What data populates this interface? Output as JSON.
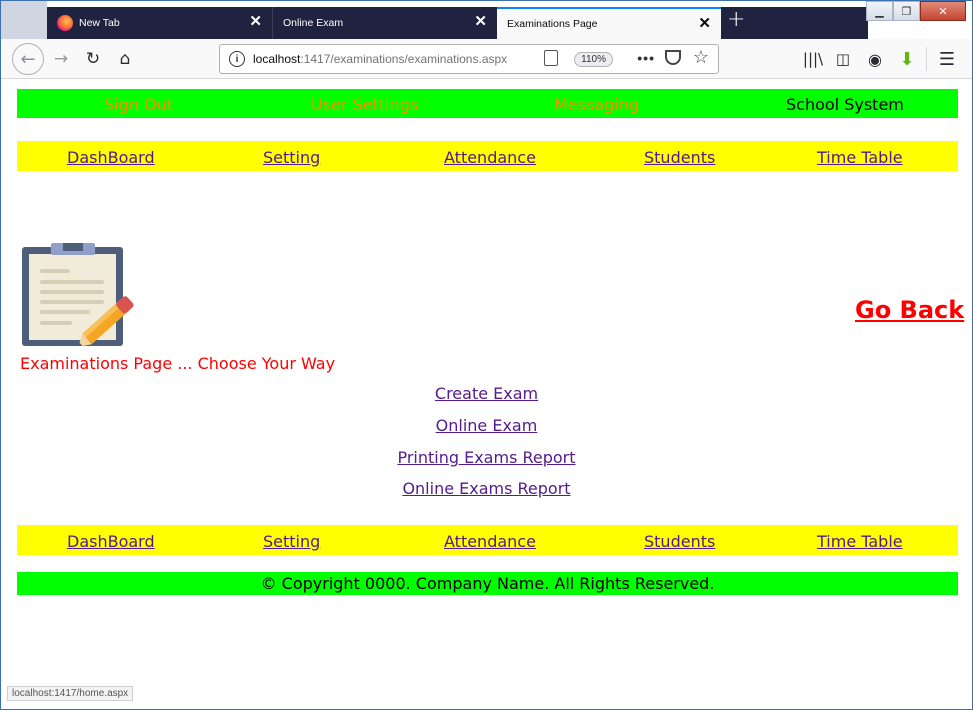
{
  "browser": {
    "tabs": [
      {
        "label": "New Tab",
        "active": false
      },
      {
        "label": "Online Exam",
        "active": false
      },
      {
        "label": "Examinations Page",
        "active": true
      }
    ],
    "url_host": "localhost",
    "url_path": ":1417/examinations/examinations.aspx",
    "zoom": "110%",
    "status_url": "localhost:1417/home.aspx"
  },
  "topbar": {
    "items": [
      "Sign Out",
      "User Settings",
      "Messaging"
    ],
    "brand": "School System",
    "bg_color": "#00ff00",
    "link_color": "#ff8c00"
  },
  "menu": {
    "items": [
      "DashBoard",
      "Setting",
      "Attendance",
      "Students",
      "Time Table"
    ],
    "bg_color": "#ffff00"
  },
  "main": {
    "go_back": "Go Back",
    "heading": "Examinations Page ... Choose Your Way",
    "choices": [
      "Create Exam",
      "Online Exam",
      "Printing Exams Report",
      "Online Exams Report"
    ]
  },
  "footer": {
    "text": "© Copyright 0000. Company Name. All Rights Reserved."
  }
}
